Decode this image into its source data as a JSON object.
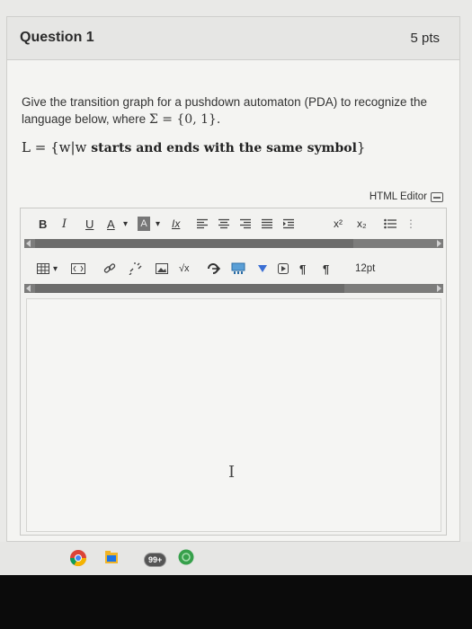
{
  "question": {
    "title": "Question 1",
    "points": "5 pts",
    "prompt_part1": "Give the transition graph for a pushdown automaton (PDA) to recognize the language below, where ",
    "prompt_sigma": "Σ = {0, 1}.",
    "language_prefix": "L = {w|w",
    "language_bold": " starts and ends with the same symbol",
    "language_suffix": "}"
  },
  "editor": {
    "html_editor_label": "HTML Editor",
    "font_size": "12pt",
    "cursor_glyph": "I"
  },
  "toolbar1": {
    "bold": "B",
    "italic": "I",
    "underline": "U",
    "text_color": "A",
    "bg_color": "A",
    "clear_format": "Ix",
    "superscript": "x²",
    "subscript": "x₂"
  },
  "toolbar2": {
    "math": "√x",
    "ltr": "¶",
    "rtl": "¶"
  },
  "taskbar": {
    "badge_count": "99+"
  },
  "colors": {
    "chrome_red": "#db4437",
    "chrome_yellow": "#f4b400",
    "chrome_green": "#0f9d58",
    "chrome_blue": "#4285f4",
    "badge_bg": "#555555",
    "accent_green": "#37a04b"
  }
}
